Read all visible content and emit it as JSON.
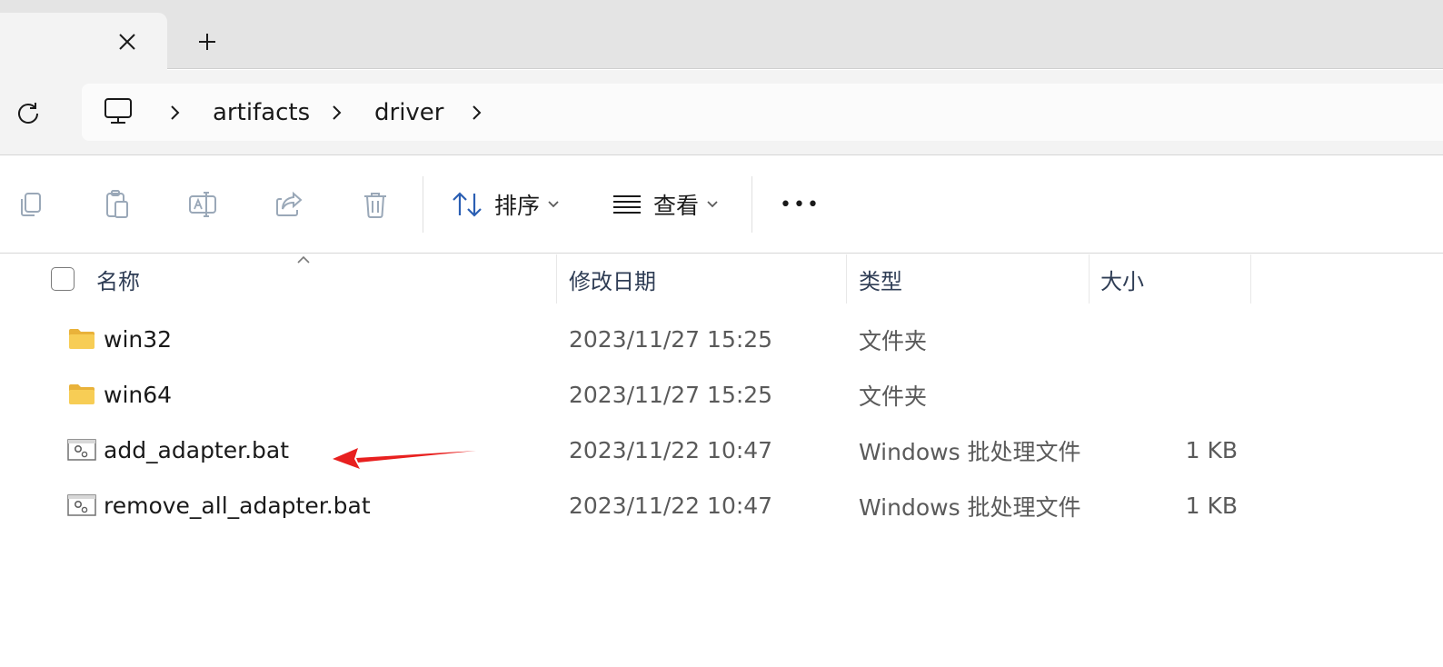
{
  "tabs": {
    "close_label": "close-tab",
    "new_label": "new-tab"
  },
  "breadcrumb": {
    "items": [
      "artifacts",
      "driver"
    ]
  },
  "toolbar": {
    "sort_label": "排序",
    "view_label": "查看",
    "more_label": "•••"
  },
  "columns": {
    "name": "名称",
    "modified": "修改日期",
    "type": "类型",
    "size": "大小"
  },
  "files": [
    {
      "name": "win32",
      "modified": "2023/11/27 15:25",
      "type": "文件夹",
      "size": "",
      "icon": "folder-icon"
    },
    {
      "name": "win64",
      "modified": "2023/11/27 15:25",
      "type": "文件夹",
      "size": "",
      "icon": "folder-icon"
    },
    {
      "name": "add_adapter.bat",
      "modified": "2023/11/22 10:47",
      "type": "Windows 批处理文件",
      "size": "1 KB",
      "icon": "batch-file-icon"
    },
    {
      "name": "remove_all_adapter.bat",
      "modified": "2023/11/22 10:47",
      "type": "Windows 批处理文件",
      "size": "1 KB",
      "icon": "batch-file-icon"
    }
  ],
  "annotation": {
    "color": "#e8201f",
    "icon": "red-arrow-icon"
  },
  "colors": {
    "folder": "#f4c94e",
    "accent": "#2b5fb3"
  }
}
